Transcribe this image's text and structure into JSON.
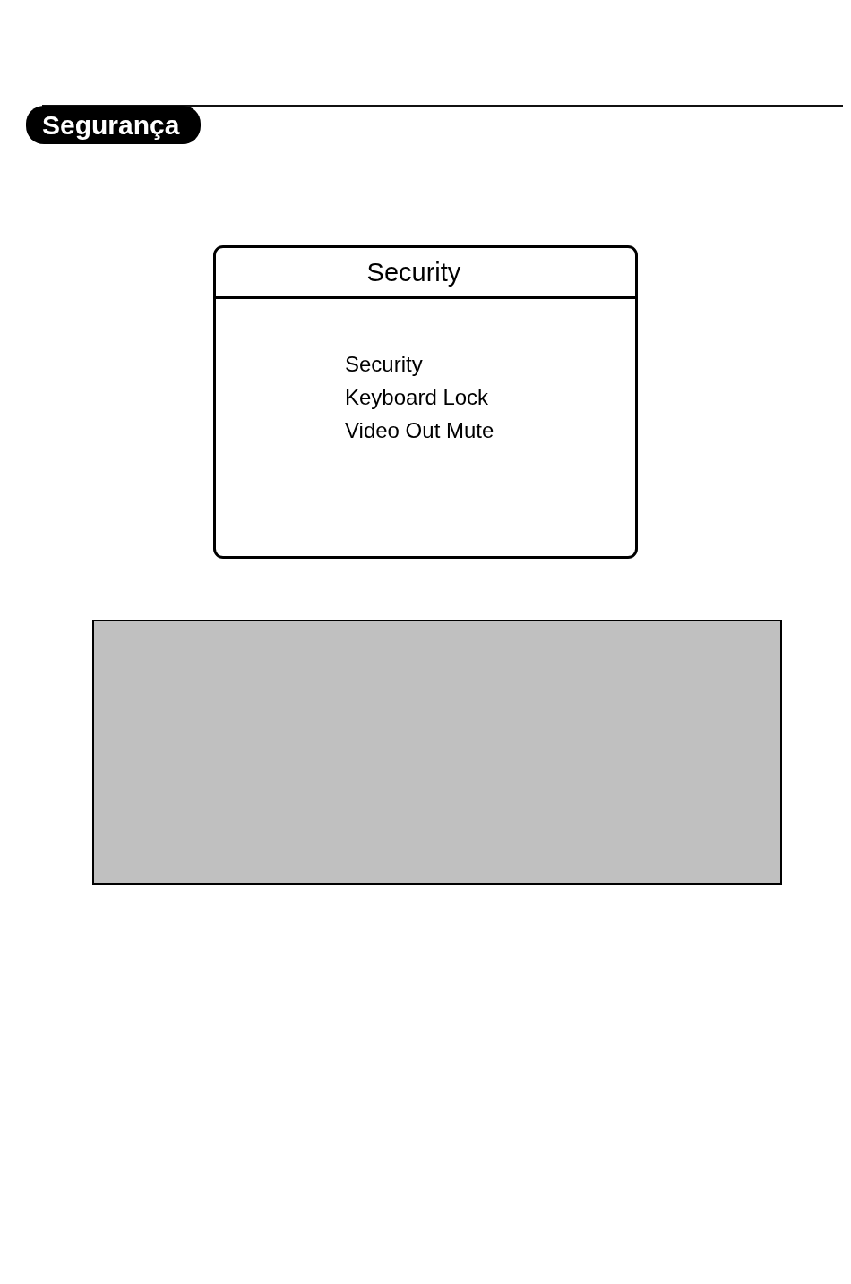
{
  "section_tab": {
    "label": "Segurança"
  },
  "menu_window": {
    "title": "Security",
    "items": [
      {
        "label": "Security"
      },
      {
        "label": "Keyboard Lock"
      },
      {
        "label": "Video Out Mute"
      }
    ]
  }
}
